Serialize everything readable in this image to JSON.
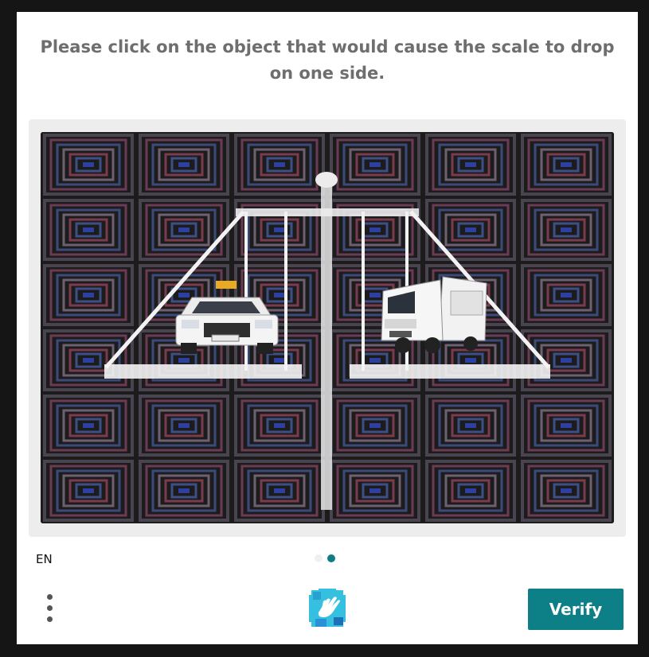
{
  "challenge": {
    "prompt": "Please click on the object that would cause the scale to drop on one side.",
    "objects": [
      "taxi-car",
      "delivery-truck"
    ]
  },
  "footer": {
    "language": "EN",
    "pages": {
      "total": 2,
      "current": 2
    },
    "verify_label": "Verify",
    "menu_icon": "more-vertical-icon",
    "logo_icon": "hand-logo-icon"
  },
  "colors": {
    "accent": "#0d7f87",
    "prompt_text": "#6e6e6e",
    "background": "#151515"
  }
}
